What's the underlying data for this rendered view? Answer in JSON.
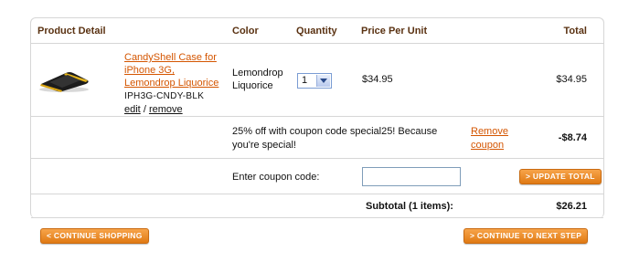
{
  "headers": {
    "product": "Product Detail",
    "color": "Color",
    "quantity": "Quantity",
    "price": "Price Per Unit",
    "total": "Total"
  },
  "item": {
    "name_line1": "CandyShell Case for",
    "name_line2": "iPhone 3G,",
    "name_line3": "Lemondrop Liquorice",
    "sku": "IPH3G-CNDY-BLK",
    "edit": "edit",
    "sep": "/",
    "remove": "remove",
    "color_line1": "Lemondrop",
    "color_line2": "Liquorice",
    "quantity": "1",
    "unit_price": "$34.95",
    "total": "$34.95"
  },
  "discount": {
    "text_line1": "25% off with coupon code special25! Because",
    "text_line2": "you're special!",
    "remove_line1": "Remove",
    "remove_line2": "coupon",
    "amount": "-$8.74"
  },
  "coupon": {
    "label": "Enter coupon code:",
    "value": "",
    "update_button": "> UPDATE TOTAL"
  },
  "subtotal": {
    "label": "Subtotal (1 items):",
    "value": "$26.21"
  },
  "buttons": {
    "continue_shopping": "< CONTINUE SHOPPING",
    "next_step": "> CONTINUE TO NEXT STEP"
  },
  "colors": {
    "accent": "#e07a14",
    "header_text": "#5a3212",
    "link": "#d45500"
  }
}
